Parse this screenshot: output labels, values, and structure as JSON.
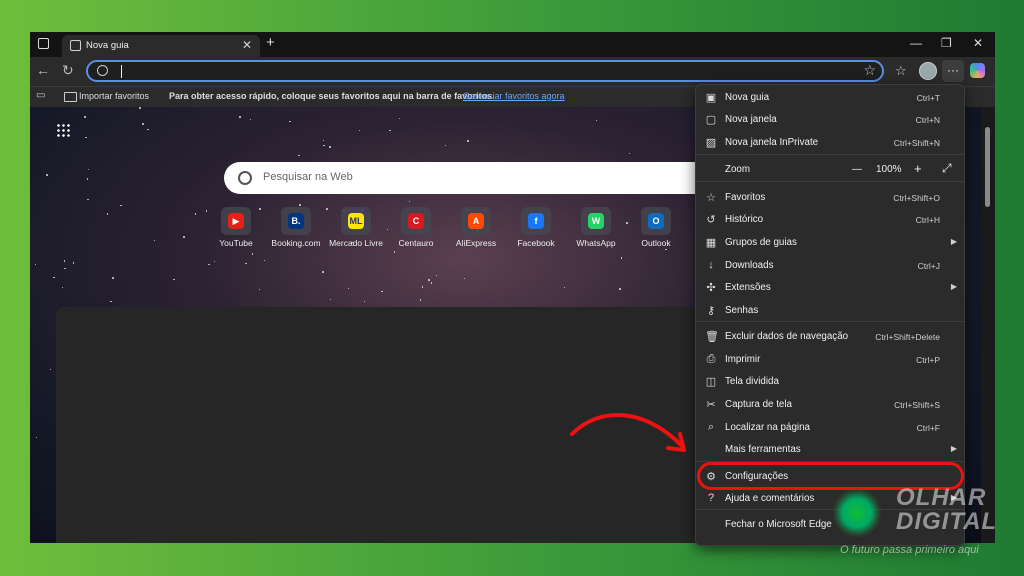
{
  "tab": {
    "title": "Nova guia",
    "close": "✕",
    "new": "+"
  },
  "window": {
    "minimize": "—",
    "maximize": "❐",
    "close": "✕"
  },
  "toolbar": {
    "back": "←",
    "refresh": "↻",
    "address_value": "",
    "more": "···"
  },
  "favorites_bar": {
    "import": "Importar favoritos",
    "hint": "Para obter acesso rápido, coloque seus favoritos aqui na barra de favoritos.",
    "manage_link": "Gerenciar favoritos agora"
  },
  "newtab": {
    "search_placeholder": "Pesquisar na Web",
    "tiles": [
      {
        "label": "YouTube",
        "color": "#e62117",
        "glyph": "▶"
      },
      {
        "label": "Booking.com",
        "color": "#003580",
        "glyph": "B."
      },
      {
        "label": "Mercado Livre",
        "color": "#ffe600",
        "glyph": "ML"
      },
      {
        "label": "Centauro",
        "color": "#d71920",
        "glyph": "C"
      },
      {
        "label": "AliExpress",
        "color": "#ff4a00",
        "glyph": "A"
      },
      {
        "label": "Facebook",
        "color": "#1877f2",
        "glyph": "f"
      },
      {
        "label": "WhatsApp",
        "color": "#25d366",
        "glyph": "W"
      },
      {
        "label": "Outlook",
        "color": "#0f6cbd",
        "glyph": "O"
      }
    ]
  },
  "menu": {
    "items": [
      {
        "label": "Nova guia",
        "shortcut": "Ctrl+T",
        "icon": "new-tab-icon",
        "glyph": "▣"
      },
      {
        "label": "Nova janela",
        "shortcut": "Ctrl+N",
        "icon": "new-window-icon",
        "glyph": "▢"
      },
      {
        "label": "Nova janela InPrivate",
        "shortcut": "Ctrl+Shift+N",
        "icon": "inprivate-icon",
        "glyph": "▨"
      },
      {
        "label": "Zoom",
        "zoom_value": "100%",
        "icon": "zoom-icon"
      },
      {
        "label": "Favoritos",
        "shortcut": "Ctrl+Shift+O",
        "icon": "favorites-icon",
        "glyph": "☆"
      },
      {
        "label": "Histórico",
        "shortcut": "Ctrl+H",
        "icon": "history-icon",
        "glyph": "↺"
      },
      {
        "label": "Grupos de guias",
        "submenu": true,
        "icon": "tab-groups-icon",
        "glyph": "▦"
      },
      {
        "label": "Downloads",
        "shortcut": "Ctrl+J",
        "icon": "download-icon",
        "glyph": "↓"
      },
      {
        "label": "Extensões",
        "submenu": true,
        "icon": "extensions-icon",
        "glyph": "✣"
      },
      {
        "label": "Senhas",
        "icon": "key-icon",
        "glyph": "⚷"
      },
      {
        "label": "Excluir dados de navegação",
        "shortcut": "Ctrl+Shift+Delete",
        "icon": "trash-icon",
        "glyph": "🗑"
      },
      {
        "label": "Imprimir",
        "shortcut": "Ctrl+P",
        "icon": "print-icon",
        "glyph": "⎙"
      },
      {
        "label": "Tela dividida",
        "icon": "split-screen-icon",
        "glyph": "◫"
      },
      {
        "label": "Captura de tela",
        "shortcut": "Ctrl+Shift+S",
        "icon": "screenshot-icon",
        "glyph": "✂"
      },
      {
        "label": "Localizar na página",
        "shortcut": "Ctrl+F",
        "icon": "find-icon",
        "glyph": "⌕"
      },
      {
        "label": "Mais ferramentas",
        "submenu": true,
        "icon": "",
        "glyph": ""
      },
      {
        "label": "Configurações",
        "icon": "gear-icon",
        "glyph": "⚙"
      },
      {
        "label": "Ajuda e comentários",
        "submenu": true,
        "icon": "help-icon",
        "glyph": "?"
      },
      {
        "label": "Fechar o Microsoft Edge",
        "icon": "",
        "glyph": ""
      }
    ]
  },
  "watermark": {
    "line1": "OLHAR",
    "line2": "DIGITAL",
    "tagline": "O futuro passa primeiro aqui"
  },
  "colors": {
    "highlight": "#e11111",
    "address_border": "#5b8ee6",
    "link": "#6aa6ff"
  }
}
